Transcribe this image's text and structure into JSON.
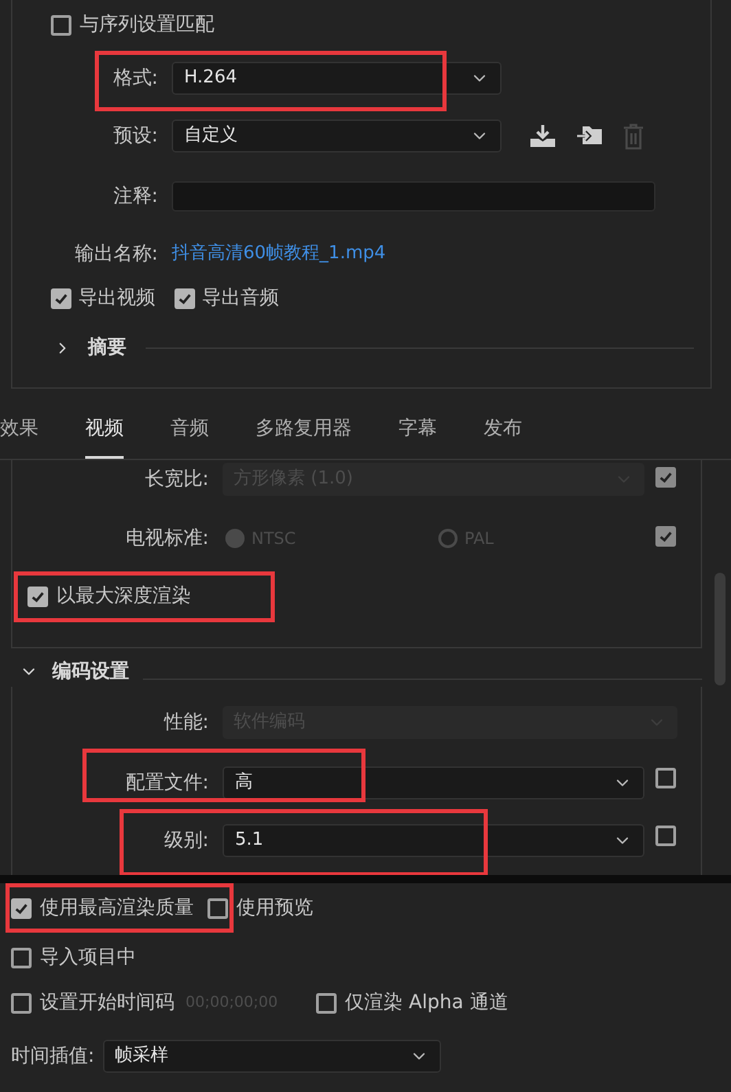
{
  "output_panel": {
    "match_sequence": {
      "label": "与序列设置匹配",
      "checked": false
    },
    "fields": [
      {
        "kind": "select",
        "label": "格式:",
        "value": "H.264",
        "highlighted": true
      },
      {
        "kind": "select_actions",
        "label": "预设:",
        "value": "自定义"
      },
      {
        "kind": "text",
        "label": "注释:"
      },
      {
        "kind": "link",
        "label": "输出名称:",
        "value": "抖音高清60帧教程_1.mp4"
      }
    ],
    "exports": [
      {
        "label": "导出视频",
        "checked": true
      },
      {
        "label": "导出音频",
        "checked": true
      }
    ],
    "summary": {
      "label": "摘要",
      "expanded": false
    }
  },
  "tabs": [
    {
      "label": "效果",
      "selected": false
    },
    {
      "label": "视频",
      "selected": true
    },
    {
      "label": "音频",
      "selected": false
    },
    {
      "label": "多路复用器",
      "selected": false
    },
    {
      "label": "字幕",
      "selected": false
    },
    {
      "label": "发布",
      "selected": false
    }
  ],
  "video": {
    "rows": [
      {
        "kind": "select",
        "label": "长宽比:",
        "value": "方形像素 (1.0)",
        "disabled": true,
        "checked": true
      },
      {
        "kind": "radio",
        "label": "电视标准:",
        "options": [
          {
            "label": "NTSC",
            "selected": true
          },
          {
            "label": "PAL",
            "selected": false
          }
        ],
        "disabled": true,
        "checked": true
      },
      {
        "kind": "checkbox",
        "label": "以最大深度渲染",
        "checked": true,
        "highlighted": true
      }
    ],
    "encoding": {
      "title": "编码设置",
      "expanded": true,
      "rows": [
        {
          "kind": "select",
          "label": "性能:",
          "value": "软件编码",
          "disabled": true
        },
        {
          "kind": "select_check",
          "label": "配置文件:",
          "value": "高",
          "disabled": false,
          "checked": false,
          "highlighted": true
        },
        {
          "kind": "select_check",
          "label": "级别:",
          "value": "5.1",
          "disabled": false,
          "checked": false,
          "highlighted": true
        }
      ]
    }
  },
  "bottom": {
    "rows": [
      [
        {
          "label": "使用最高渲染质量",
          "checked": true,
          "highlighted": true
        },
        {
          "label": "使用预览",
          "checked": false
        }
      ],
      [
        {
          "label": "导入项目中",
          "checked": false
        }
      ],
      [
        {
          "label": "设置开始时间码",
          "checked": false,
          "timecode": "00;00;00;00"
        },
        {
          "label": "仅渲染 Alpha 通道",
          "checked": false
        }
      ]
    ],
    "time_interpolation": {
      "label": "时间插值:",
      "value": "帧采样"
    }
  }
}
